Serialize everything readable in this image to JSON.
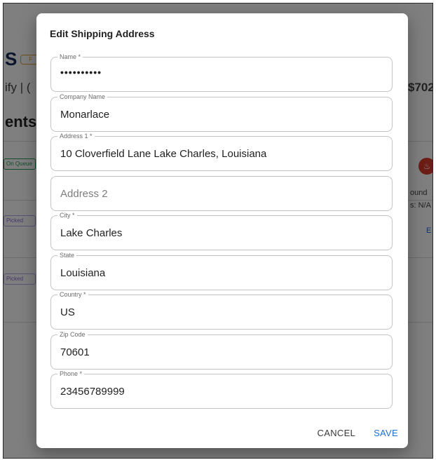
{
  "background": {
    "logo": "S",
    "tag": "F",
    "breadcrumb": "ify | (",
    "order_id": "$702",
    "heading": "ents",
    "badges": [
      "On Queue",
      "Picked",
      "Picked"
    ],
    "side_text_1": "ound",
    "side_text_2": "s: N/A",
    "side_link": "E"
  },
  "modal": {
    "title": "Edit Shipping Address",
    "fields": [
      {
        "label": "Name *",
        "value": "••••••••••"
      },
      {
        "label": "Company Name",
        "value": "Monarlace"
      },
      {
        "label": "Address 1 *",
        "value": "10 Cloverfield Lane Lake Charles, Louisiana"
      },
      {
        "label": "",
        "value": "",
        "placeholder": "Address 2"
      },
      {
        "label": "City *",
        "value": "Lake Charles"
      },
      {
        "label": "State",
        "value": "Louisiana"
      },
      {
        "label": "Country *",
        "value": "US"
      },
      {
        "label": "Zip Code",
        "value": "70601"
      },
      {
        "label": "Phone *",
        "value": "23456789999"
      }
    ],
    "cancel_label": "CANCEL",
    "save_label": "SAVE"
  },
  "colors": {
    "accent": "#1e6fd9",
    "overlay": "rgba(0,0,0,0.5)"
  },
  "icons": {
    "fire": "fire-icon"
  }
}
